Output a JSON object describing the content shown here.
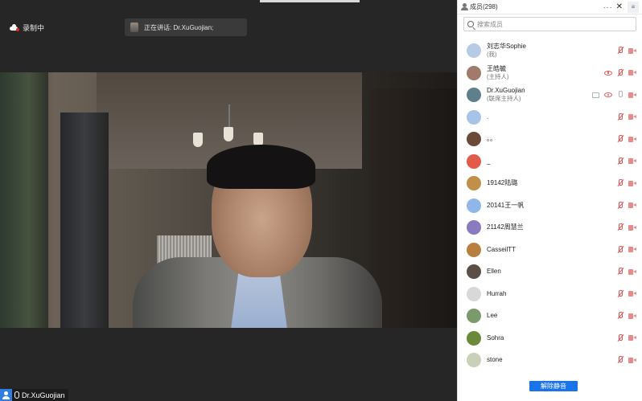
{
  "recording": {
    "label": "录制中"
  },
  "speaking": {
    "label": "正在讲话: Dr.XuGuojian;"
  },
  "video": {
    "name_tag": "Dr.XuGuojian"
  },
  "panel": {
    "title": "成员(298)",
    "more_label": "···",
    "close_label": "✕",
    "menu_label": "≡",
    "search_placeholder": "搜索成员",
    "unmute_all_label": "解除静音",
    "members": [
      {
        "name": "刘志华Sophie",
        "role": "(我)",
        "avatar_color": "#b8cbe6",
        "icons": [
          "mic-off",
          "cam-off"
        ]
      },
      {
        "name": "王皓毓",
        "role": "(主持人)",
        "avatar_color": "#a07a6a",
        "icons": [
          "eye",
          "mic-off",
          "cam-off"
        ]
      },
      {
        "name": "Dr.XuGuojian",
        "role": "(联席主持人)",
        "avatar_color": "#5f7f8c",
        "icons": [
          "screen",
          "eye",
          "mic-on",
          "cam-off"
        ]
      },
      {
        "name": ".",
        "role": "",
        "avatar_color": "#a7c4e8",
        "icons": [
          "mic-off",
          "cam-off"
        ]
      },
      {
        "name": "。。",
        "role": "",
        "avatar_color": "#6a4b3a",
        "icons": [
          "mic-off",
          "cam-off"
        ]
      },
      {
        "name": "_",
        "role": "",
        "avatar_color": "#e25a4a",
        "icons": [
          "mic-off",
          "cam-off"
        ]
      },
      {
        "name": "19142陆璐",
        "role": "",
        "avatar_color": "#c0904a",
        "icons": [
          "mic-off",
          "cam-off"
        ]
      },
      {
        "name": "20141王一帆",
        "role": "",
        "avatar_color": "#8fb8e8",
        "icons": [
          "mic-off",
          "cam-off"
        ]
      },
      {
        "name": "21142周慧兰",
        "role": "",
        "avatar_color": "#8a7ac0",
        "icons": [
          "mic-off",
          "cam-off"
        ]
      },
      {
        "name": "CasseilTT",
        "role": "",
        "avatar_color": "#b88040",
        "icons": [
          "mic-off",
          "cam-off"
        ]
      },
      {
        "name": "Ellen",
        "role": "",
        "avatar_color": "#5a5048",
        "icons": [
          "mic-off",
          "cam-off"
        ]
      },
      {
        "name": "Hurrah",
        "role": "",
        "avatar_color": "#d8d8d8",
        "icons": [
          "mic-off",
          "cam-off"
        ]
      },
      {
        "name": "Lee",
        "role": "",
        "avatar_color": "#7a9a6a",
        "icons": [
          "mic-off",
          "cam-off"
        ]
      },
      {
        "name": "Sohra",
        "role": "",
        "avatar_color": "#6a8a3a",
        "icons": [
          "mic-off",
          "cam-off"
        ]
      },
      {
        "name": "stone",
        "role": "",
        "avatar_color": "#c8d0b8",
        "icons": [
          "mic-off",
          "cam-off"
        ]
      }
    ]
  }
}
